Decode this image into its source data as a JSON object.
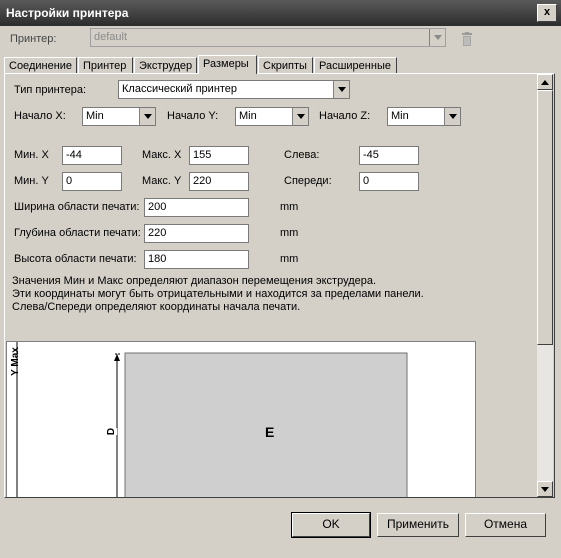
{
  "window": {
    "title": "Настройки принтера",
    "close_label": "x"
  },
  "printer": {
    "label": "Принтер:",
    "value": "default"
  },
  "tabs": [
    {
      "label": "Соединение"
    },
    {
      "label": "Принтер"
    },
    {
      "label": "Экструдер"
    },
    {
      "label": "Размеры"
    },
    {
      "label": "Скрипты"
    },
    {
      "label": "Расширенные"
    }
  ],
  "active_tab": "Размеры",
  "dimensions": {
    "printer_type_label": "Тип принтера:",
    "printer_type_value": "Классический принтер",
    "home_x_label": "Начало X:",
    "home_x_value": "Min",
    "home_y_label": "Начало Y:",
    "home_y_value": "Min",
    "home_z_label": "Начало Z:",
    "home_z_value": "Min",
    "min_x_label": "Мин. X",
    "min_x_value": "-44",
    "max_x_label": "Макс. X",
    "max_x_value": "155",
    "left_label": "Слева:",
    "left_value": "-45",
    "min_y_label": "Мин. Y",
    "min_y_value": "0",
    "max_y_label": "Макс. Y",
    "max_y_value": "220",
    "front_label": "Спереди:",
    "front_value": "0",
    "width_label": "Ширина области печати:",
    "width_value": "200",
    "width_unit": "mm",
    "depth_label": "Глубина области печати:",
    "depth_value": "220",
    "depth_unit": "mm",
    "height_label": "Высота области печати:",
    "height_value": "180",
    "height_unit": "mm",
    "help_line1": "Значения Мин и Макс определяют диапазон перемещения экструдера.",
    "help_line2": "Эти координаты могут быть отрицательными и находится за пределами панели.",
    "help_line3": "Слева/Спереди определяют координаты начала печати."
  },
  "diagram": {
    "y_max_label": "Y Max",
    "d_label": "D",
    "e_label": "E"
  },
  "buttons": {
    "ok": "OK",
    "apply": "Применить",
    "cancel": "Отмена"
  }
}
